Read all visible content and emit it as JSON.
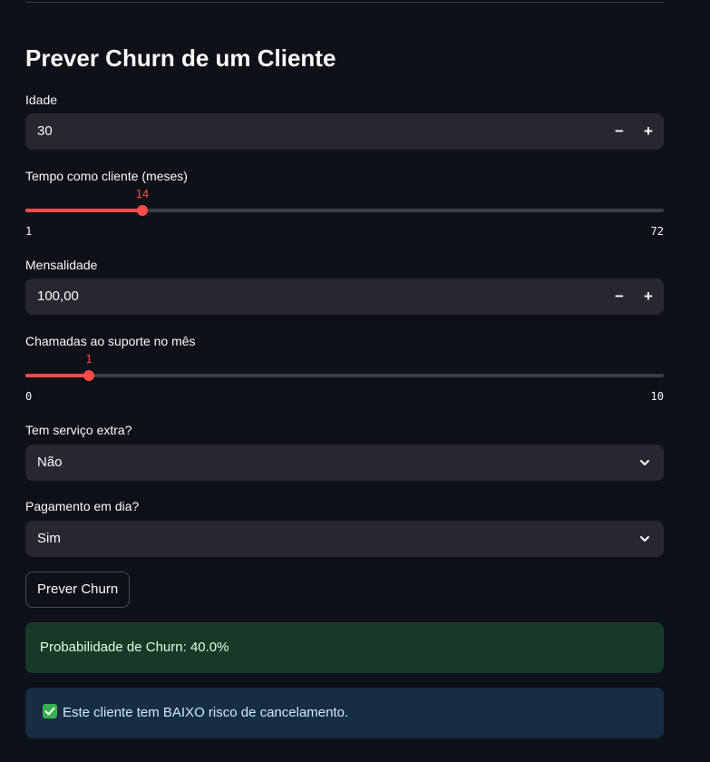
{
  "page": {
    "title": "Prever Churn de um Cliente"
  },
  "fields": {
    "idade": {
      "label": "Idade",
      "value": "30",
      "minus": "−",
      "plus": "+"
    },
    "tempo": {
      "label": "Tempo como cliente (meses)",
      "value": "14",
      "min": "1",
      "max": "72",
      "fraction": 0.183
    },
    "mensalidade": {
      "label": "Mensalidade",
      "value": "100,00",
      "minus": "−",
      "plus": "+"
    },
    "chamadas": {
      "label": "Chamadas ao suporte no mês",
      "value": "1",
      "min": "0",
      "max": "10",
      "fraction": 0.1
    },
    "servico_extra": {
      "label": "Tem serviço extra?",
      "selected": "Não"
    },
    "pagamento": {
      "label": "Pagamento em dia?",
      "selected": "Sim"
    }
  },
  "action": {
    "button_label": "Prever Churn"
  },
  "result": {
    "probability_text": "Probabilidade de Churn: 40.0%",
    "risk_text": "Este cliente tem BAIXO risco de cancelamento.",
    "risk_icon": "check-mark-icon"
  },
  "colors": {
    "accent": "#ff4b4b",
    "background": "#0e1117",
    "input_bg": "#262730",
    "success_bg": "#173928",
    "info_bg": "#172d43"
  }
}
